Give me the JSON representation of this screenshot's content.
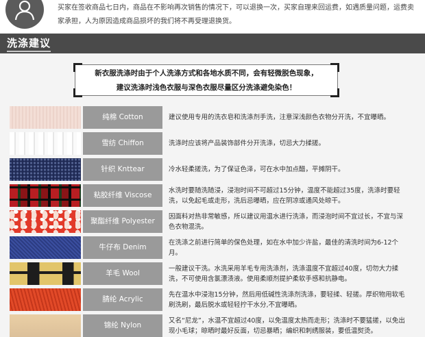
{
  "notice": {
    "text": "买家在签收商品七日内，商品在不影响再次销售的情况下，可以退换一次，买家自理来回运费，如遇质量问题，运费卖家承担，人为原因造成商品损坏的我们将不再受理退换货。"
  },
  "section": {
    "title": "洗涤建议"
  },
  "intro": {
    "line1": "新衣服洗涤时由于个人洗涤方式和各地水质不同，会有轻微脱色现象，",
    "line2": "建议洗涤时浅色衣服与深色衣服尽量区分洗涤避免染色！"
  },
  "fabrics": [
    {
      "key": "cotton",
      "name": "纯棉 Cotton",
      "desc": "建议使用专用的洗衣皂和洗涤剂手洗，注意深浅颜色衣物分开洗，不宜曝晒。"
    },
    {
      "key": "chiffon",
      "name": "雪纺 Chiffon",
      "desc": "洗涤时应该将产品装饰部件分开洗涤，切忌大力揉搓。"
    },
    {
      "key": "knit",
      "name": "针织 Knttear",
      "desc": "冷水轻柔搓洗，为了保证色泽，可在水中加点醋，平摊阴干。"
    },
    {
      "key": "viscose",
      "name": "粘胶纤维 Viscose",
      "desc": "水洗时要随洗随浸，浸泡时间不可超过15分钟，温度不能超过35度，洗涤时要轻洗，以免起毛或走形，洗后忌曝晒，应在阴凉或通风处晾干。"
    },
    {
      "key": "poly",
      "name": "聚酯纤维 Polyester",
      "desc": "因面料对热非常敏感，所以建议用温水进行洗涤，而浸泡时间不宜过长，不宜与深色衣物混洗。"
    },
    {
      "key": "denim",
      "name": "牛仔布 Denim",
      "desc": "在洗涤之前进行简单的保色处理，如在水中加少许盐，最佳的清洗时间为6-12个月。"
    },
    {
      "key": "wool",
      "name": "羊毛 Wool",
      "desc": "一般建议干洗。水洗采用羊毛专用洗涤剂，洗涤温度不宜超过40度，切勿大力揉洗，不可使用含氯漂渍液。使用柔顺剂提护柔软手感和抗静电。"
    },
    {
      "key": "acrylic",
      "name": "腈纶 Acrylic",
      "desc": "先在温水中浸泡15分钟，然后用低碱性洗涤剂洗涤，要轻揉、轻搓。厚织物用软毛刷洗刷，最后脱水或轻轻拧干水分,不宜曝晒。"
    },
    {
      "key": "nylon",
      "name": "锦纶 Nylon",
      "desc": "又名“尼龙”，水温不宜超过40度，以免温度太热而走形；洗涤时不要猛搓，以免出现小毛球；晾晒时最好反面，切忌暴晒；编织和刺绣服装，要低温熨烫。"
    }
  ],
  "colors": {
    "bar": "#4a4a4a",
    "label_bg": "#9a9a9a",
    "page_bg": "#f4f4f4"
  },
  "icons": {
    "avatar": "user-icon"
  }
}
